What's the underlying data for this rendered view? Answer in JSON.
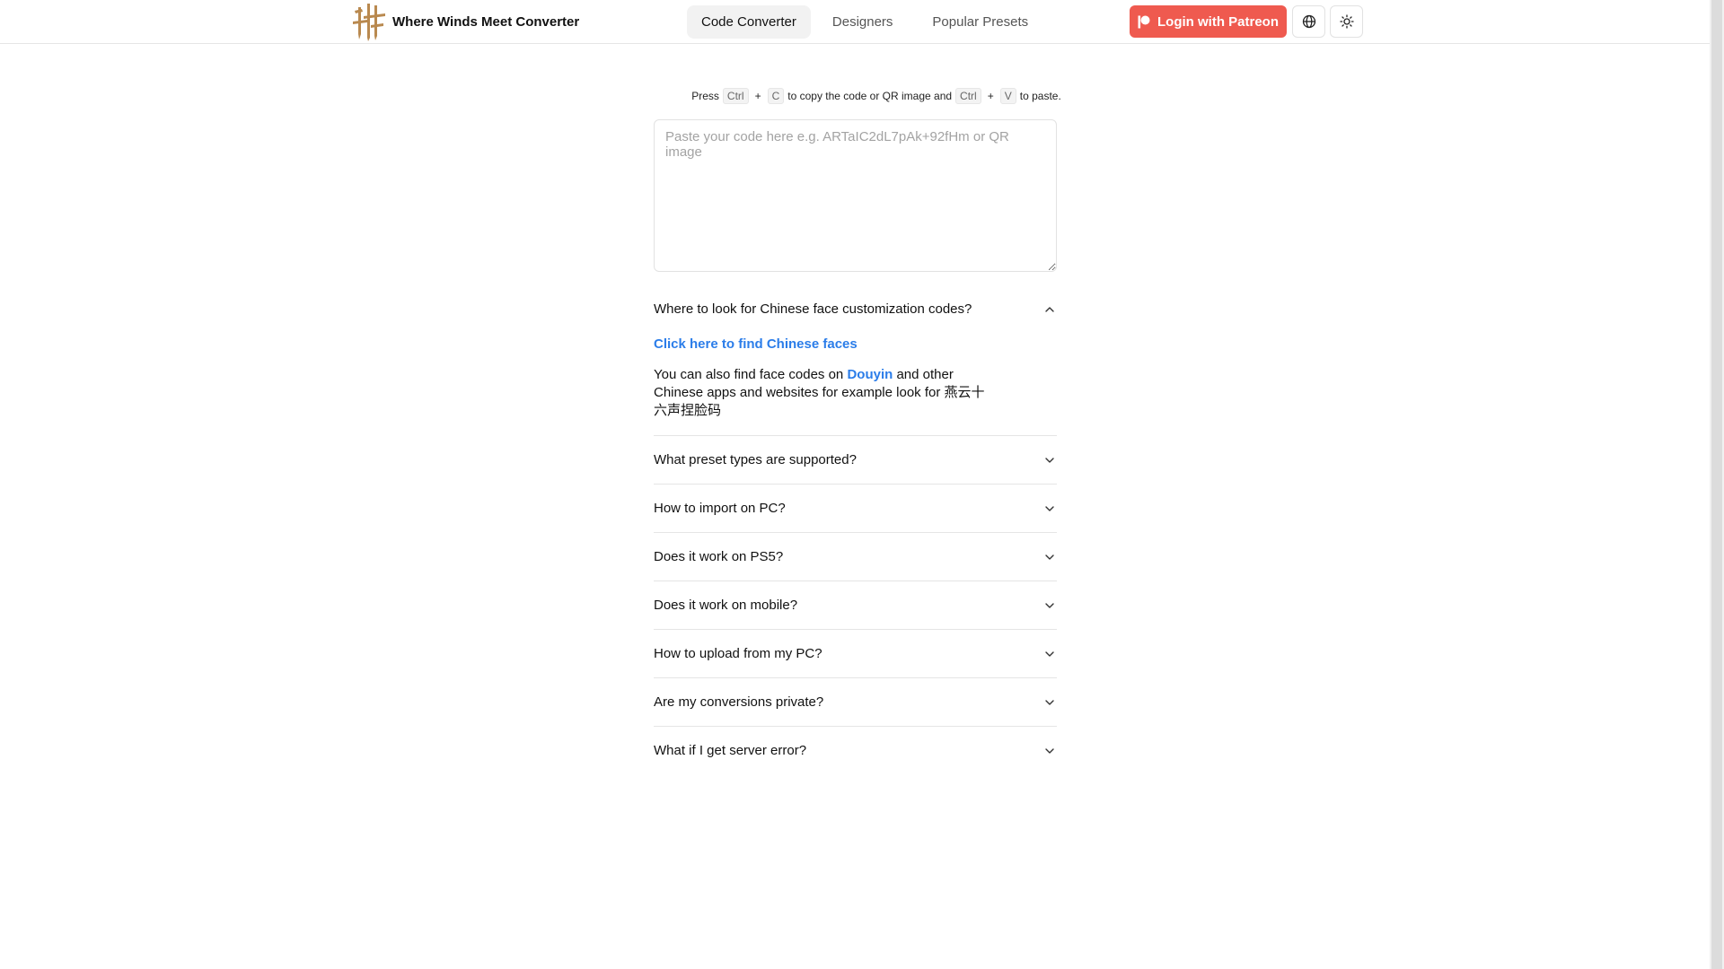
{
  "header": {
    "brand_name": "Where Winds Meet Converter",
    "tabs": [
      {
        "label": "Code Converter",
        "active": true
      },
      {
        "label": "Designers",
        "active": false
      },
      {
        "label": "Popular Presets",
        "active": false
      }
    ],
    "login_label": "Login with Patreon",
    "icons": [
      "globe-icon",
      "sun-icon"
    ]
  },
  "hint": {
    "press": "Press",
    "key_ctrl": "Ctrl",
    "plus": "+",
    "key_c": "C",
    "middle": "to copy the code or QR image and",
    "key_v": "V",
    "end": "to paste."
  },
  "code_input": {
    "placeholder": "Paste your code here e.g. ARTaIC2dL7pAk+92fHm or QR image",
    "value": ""
  },
  "faq": {
    "open_item": {
      "question": "Where to look for Chinese face customization codes?",
      "link": "Click here to find Chinese faces",
      "text_before": "You can also find face codes on",
      "douyin": "Douyin",
      "text_after": "and other Chinese apps and websites for example look for 燕云十六声捏脸码"
    },
    "items": [
      {
        "question": "What preset types are supported?"
      },
      {
        "question": "How to import on PC?"
      },
      {
        "question": "Does it work on PS5?"
      },
      {
        "question": "Does it work on mobile?"
      },
      {
        "question": "How to upload from my PC?"
      },
      {
        "question": "Are my conversions private?"
      },
      {
        "question": "What if I get server error?"
      }
    ]
  },
  "colors": {
    "accent_patreon": "#ef5a4f",
    "link_blue": "#2b7de9",
    "logo_gold": "#b9894f"
  }
}
